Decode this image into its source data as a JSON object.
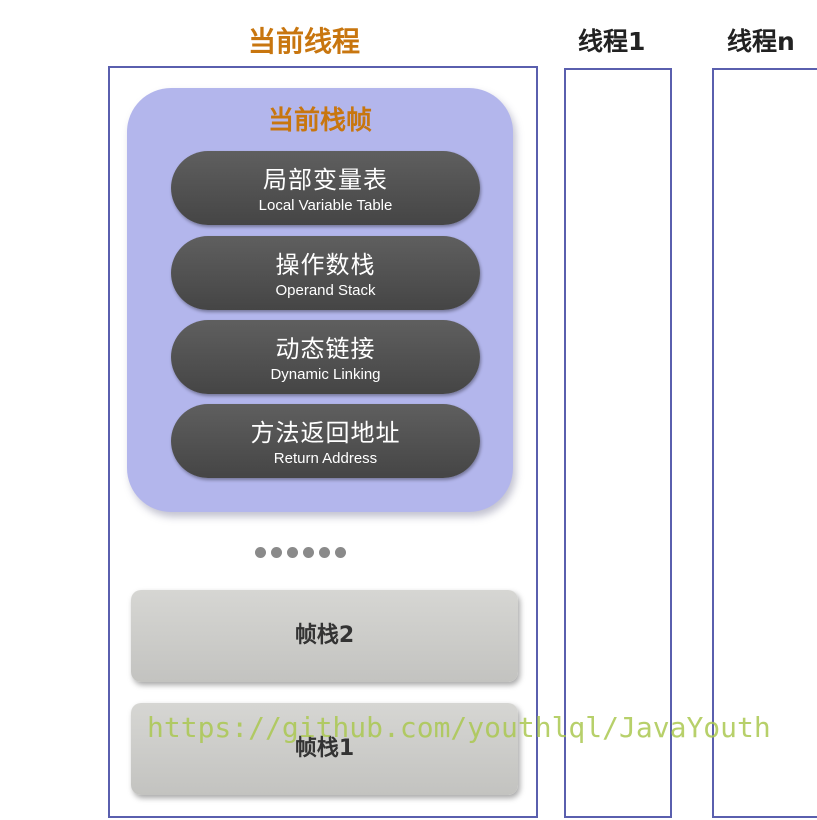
{
  "current_thread": {
    "title": "当前线程",
    "current_frame": {
      "title": "当前栈帧",
      "slots": [
        {
          "cn": "局部变量表",
          "en": "Local Variable Table"
        },
        {
          "cn": "操作数栈",
          "en": "Operand Stack"
        },
        {
          "cn": "动态链接",
          "en": "Dynamic Linking"
        },
        {
          "cn": "方法返回地址",
          "en": "Return Address"
        }
      ]
    },
    "ellipsis_dot_count": 6,
    "frames": [
      {
        "label": "帧栈2"
      },
      {
        "label": "帧栈1"
      }
    ]
  },
  "threads": [
    {
      "title": "线程1"
    },
    {
      "title": "线程n"
    }
  ],
  "watermark": "https://github.com/youthlql/JavaYouth",
  "colors": {
    "title_orange": "#c8760f",
    "frame_lavender": "#b3b6ec",
    "thread_border": "#5a5fae",
    "slot_dark": "#4f4f4f",
    "stack_frame_gray": "#cbcbc8",
    "watermark_green": "#aac850"
  }
}
